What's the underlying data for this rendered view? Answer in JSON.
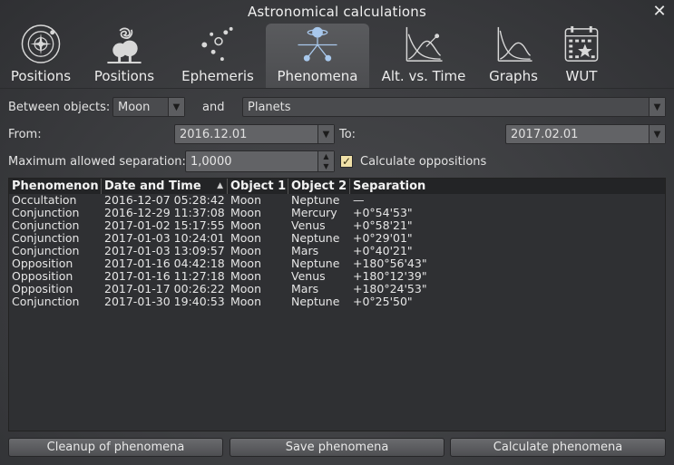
{
  "window": {
    "title": "Astronomical calculations"
  },
  "tabs": [
    {
      "label": "Positions",
      "icon": "solar-system-icon"
    },
    {
      "label": "Positions",
      "icon": "galaxy-tree-icon"
    },
    {
      "label": "Ephemeris",
      "icon": "ephemeris-dots-icon"
    },
    {
      "label": "Phenomena",
      "icon": "phenomena-planets-icon",
      "active": true
    },
    {
      "label": "Alt. vs. Time",
      "icon": "altitude-graph-icon"
    },
    {
      "label": "Graphs",
      "icon": "graphs-icon"
    },
    {
      "label": "WUT",
      "icon": "calendar-star-icon"
    }
  ],
  "controls": {
    "between_label": "Between objects:",
    "object1": "Moon",
    "and_label": "and",
    "object2": "Planets",
    "from_label": "From:",
    "from_date": "2016.12.01",
    "to_label": "To:",
    "to_date": "2017.02.01",
    "max_sep_label": "Maximum allowed separation:",
    "max_sep_value": "1,0000",
    "oppositions_label": "Calculate oppositions",
    "oppositions_checked": true
  },
  "table": {
    "headers": [
      "Phenomenon",
      "Date and Time",
      "Object 1",
      "Object 2",
      "Separation"
    ],
    "rows": [
      [
        "Occultation",
        "2016-12-07 05:28:42",
        "Moon",
        "Neptune",
        "—"
      ],
      [
        "Conjunction",
        "2016-12-29 11:37:08",
        "Moon",
        "Mercury",
        "+0°54'53\""
      ],
      [
        "Conjunction",
        "2017-01-02 15:17:55",
        "Moon",
        "Venus",
        "+0°58'21\""
      ],
      [
        "Conjunction",
        "2017-01-03 10:24:01",
        "Moon",
        "Neptune",
        "+0°29'01\""
      ],
      [
        "Conjunction",
        "2017-01-03 13:09:57",
        "Moon",
        "Mars",
        "+0°40'21\""
      ],
      [
        "Opposition",
        "2017-01-16 04:42:18",
        "Moon",
        "Neptune",
        "+180°56'43\""
      ],
      [
        "Opposition",
        "2017-01-16 11:27:18",
        "Moon",
        "Venus",
        "+180°12'39\""
      ],
      [
        "Opposition",
        "2017-01-17 00:26:22",
        "Moon",
        "Mars",
        "+180°24'53\""
      ],
      [
        "Conjunction",
        "2017-01-30 19:40:53",
        "Moon",
        "Neptune",
        "+0°25'50\""
      ]
    ]
  },
  "buttons": {
    "cleanup": "Cleanup of phenomena",
    "save": "Save phenomena",
    "calculate": "Calculate phenomena"
  },
  "colors": {
    "checkbox": "#f0e1a8",
    "active_tab": "#55565a",
    "icon": "#d8d8d8"
  }
}
